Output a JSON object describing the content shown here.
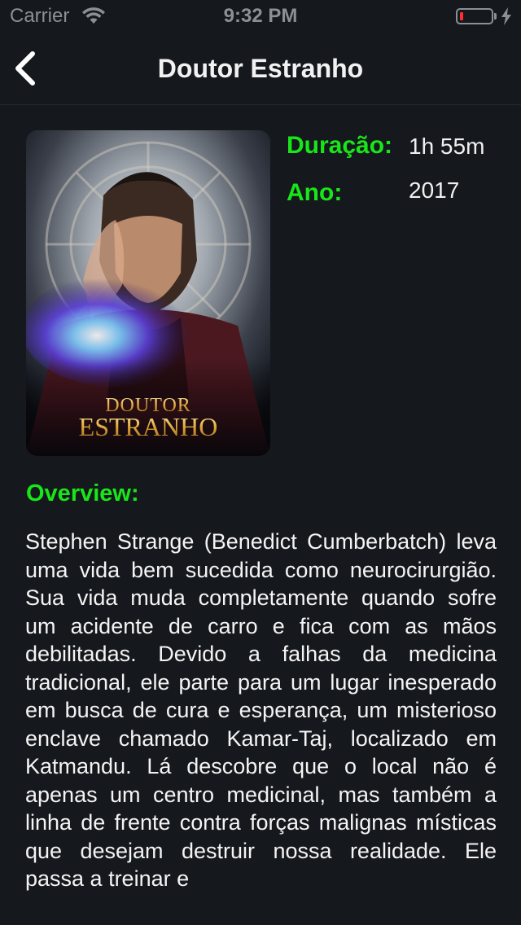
{
  "status_bar": {
    "carrier": "Carrier",
    "time": "9:32 PM",
    "battery_level": 0.1,
    "battery_color": "#ff2d2d"
  },
  "nav": {
    "title": "Doutor Estranho",
    "back_icon": "chevron-left-icon"
  },
  "movie": {
    "poster_title_line1": "DOUTOR",
    "poster_title_line2": "ESTRANHO",
    "duration_label": "Duração:",
    "duration_value": "1h 55m",
    "year_label": "Ano:",
    "year_value": "2017",
    "overview_label": "Overview:",
    "overview_text": "Stephen Strange (Benedict Cumberbatch) leva uma vida bem sucedida como neurocirurgião. Sua vida muda completamente quando sofre um acidente de carro e fica com as mãos debilitadas. Devido a falhas da medicina tradicional, ele parte para um lugar inesperado em busca de cura e esperança, um misterioso enclave chamado Kamar-Taj, localizado em Katmandu. Lá descobre que o local não é apenas um centro medicinal, mas também a linha de frente contra forças malignas místicas que desejam destruir nossa realidade. Ele passa a treinar e"
  },
  "colors": {
    "background": "#15181d",
    "accent_green": "#19e619",
    "text": "#f4f4f4",
    "status_gray": "#8c8f94"
  }
}
